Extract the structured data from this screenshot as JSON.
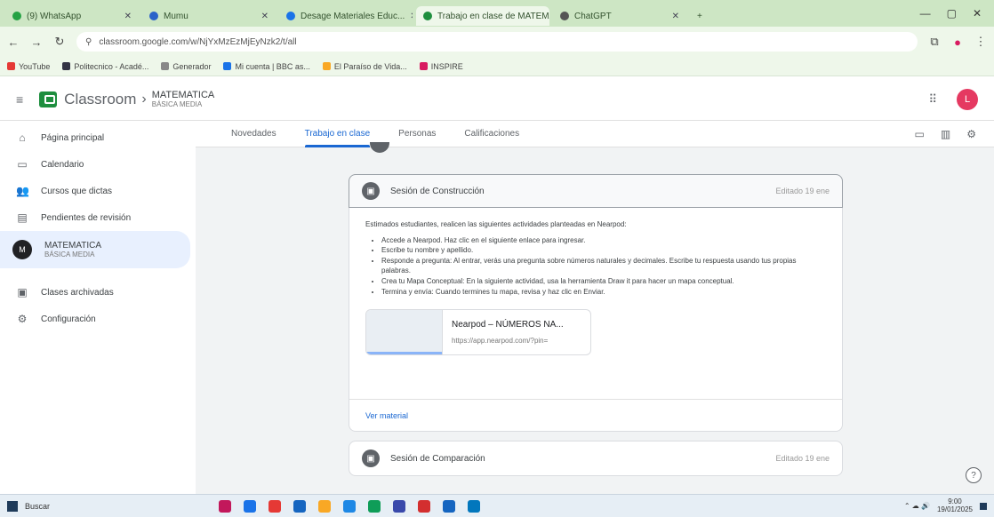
{
  "browser": {
    "tabs": [
      {
        "label": "(9) WhatsApp",
        "color": "#25a244"
      },
      {
        "label": "Mumu",
        "color": "#2a62c9"
      },
      {
        "label": "Desage Materiales Educ...",
        "color": "#1a73e8"
      },
      {
        "label": "Trabajo en clase de MATEMATICA",
        "color": "#1e8e3e",
        "active": true
      },
      {
        "label": "ChatGPT",
        "color": "#555555"
      }
    ],
    "url": "classroom.google.com/w/NjYxMzEzMjEyNzk2/t/all",
    "bookmarks": [
      {
        "label": "YouTube",
        "color": "#e53935"
      },
      {
        "label": "Politecnico - Acadé...",
        "color": "#334"
      },
      {
        "label": "Generador",
        "color": "#888"
      },
      {
        "label": "Mi cuenta | BBC as...",
        "color": "#1a73e8"
      },
      {
        "label": "El Paraíso de Vida...",
        "color": "#f9a825"
      },
      {
        "label": "INSPIRE",
        "color": "#d81b60"
      }
    ]
  },
  "header": {
    "app_title": "Classroom",
    "course_name": "MATEMATICA",
    "course_sub": "BÁSICA MEDIA",
    "avatar_letter": "L"
  },
  "sidebar": {
    "items": [
      {
        "label": "Página principal",
        "icon": "⌂"
      },
      {
        "label": "Calendario",
        "icon": "▭"
      },
      {
        "label": "Cursos que dictas",
        "icon": "👥"
      },
      {
        "label": "Pendientes de revisión",
        "icon": "▤"
      }
    ],
    "selected": {
      "label": "MATEMATICA",
      "sub": "BÁSICA MEDIA",
      "letter": "M"
    },
    "bottom": [
      {
        "label": "Clases archivadas",
        "icon": "▣"
      },
      {
        "label": "Configuración",
        "icon": "⚙"
      }
    ]
  },
  "tabs": [
    "Novedades",
    "Trabajo en clase",
    "Personas",
    "Calificaciones"
  ],
  "assignment": {
    "title": "Sesión de Construcción",
    "date": "Editado 19 ene",
    "intro": "Estimados estudiantes, realicen las siguientes actividades planteadas en Nearpod:",
    "steps": [
      "Accede a Nearpod. Haz clic en el siguiente enlace para ingresar.",
      "Escribe tu nombre y apellido.",
      "Responde a pregunta: Al entrar, verás una pregunta sobre números naturales y decimales. Escribe tu respuesta usando tus propias palabras.",
      "Crea tu Mapa Conceptual: En la siguiente actividad, usa la herramienta Draw it para hacer un mapa conceptual.",
      "Termina y envía: Cuando termines tu mapa, revisa y haz clic en Enviar."
    ],
    "attachment_title": "Nearpod – NÚMEROS NA...",
    "attachment_url": "https://app.nearpod.com/?pin=",
    "view_material": "Ver material"
  },
  "assignment2": {
    "title": "Sesión de Comparación",
    "date": "Editado 19 ene"
  },
  "taskbar": {
    "search": "Buscar",
    "time": "9:00",
    "date": "19/01/2025"
  }
}
